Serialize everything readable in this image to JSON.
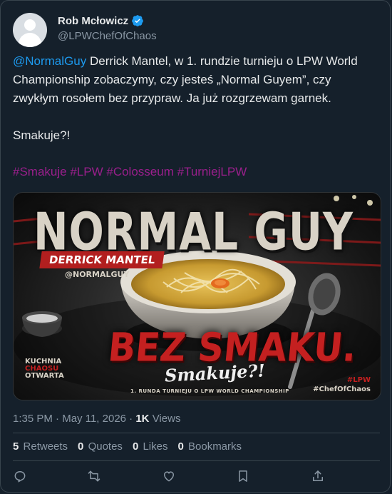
{
  "author": {
    "display_name": "Rob Mcłowicz",
    "handle": "@LPWChefOfChaos",
    "avatar_icon": "default-avatar-icon",
    "verified_icon": "verified-badge-icon"
  },
  "tweet": {
    "mention": "@NormalGuy",
    "body": " Derrick Mantel, w 1. rundzie turnieju o LPW World Championship zobaczymy, czy jesteś „Normal Guyem”, czy zwykłym rosołem bez przypraw. Ja już rozgrzewam garnek.\n\nSmakuje?!",
    "hashtags": [
      "#Smakuje",
      "#LPW",
      "#Colosseum",
      "#TurniejLPW"
    ]
  },
  "media": {
    "title": "NORMAL GUY",
    "banner": "DERRICK MANTEL",
    "handle": "@NORMALGUY",
    "headline": "BEZ SMAKU.",
    "tagline": "Smakuje?!",
    "subline": "1. RUNDA TURNIEJU O LPW WORLD CHAMPIONSHIP",
    "logo_lines": [
      "KUCHNIA",
      "CHAOSU",
      "OTWARTA"
    ],
    "tags": [
      "#LPW",
      "#ChefOfChaos"
    ]
  },
  "meta": {
    "time": "1:35 PM",
    "separator": " · ",
    "date": "May 11, 2026",
    "views_count": "1K",
    "views_label": " Views"
  },
  "stats": [
    {
      "count": "5",
      "label": "Retweets"
    },
    {
      "count": "0",
      "label": "Quotes"
    },
    {
      "count": "0",
      "label": "Likes"
    },
    {
      "count": "0",
      "label": "Bookmarks"
    }
  ],
  "actions": [
    "reply-icon",
    "retweet-icon",
    "like-icon",
    "bookmark-icon",
    "share-icon"
  ],
  "colors": {
    "background": "#15202b",
    "link": "#1d9bf0",
    "hashtag": "#9a1f8c",
    "muted": "#8b98a5",
    "accent_red": "#c42020"
  }
}
